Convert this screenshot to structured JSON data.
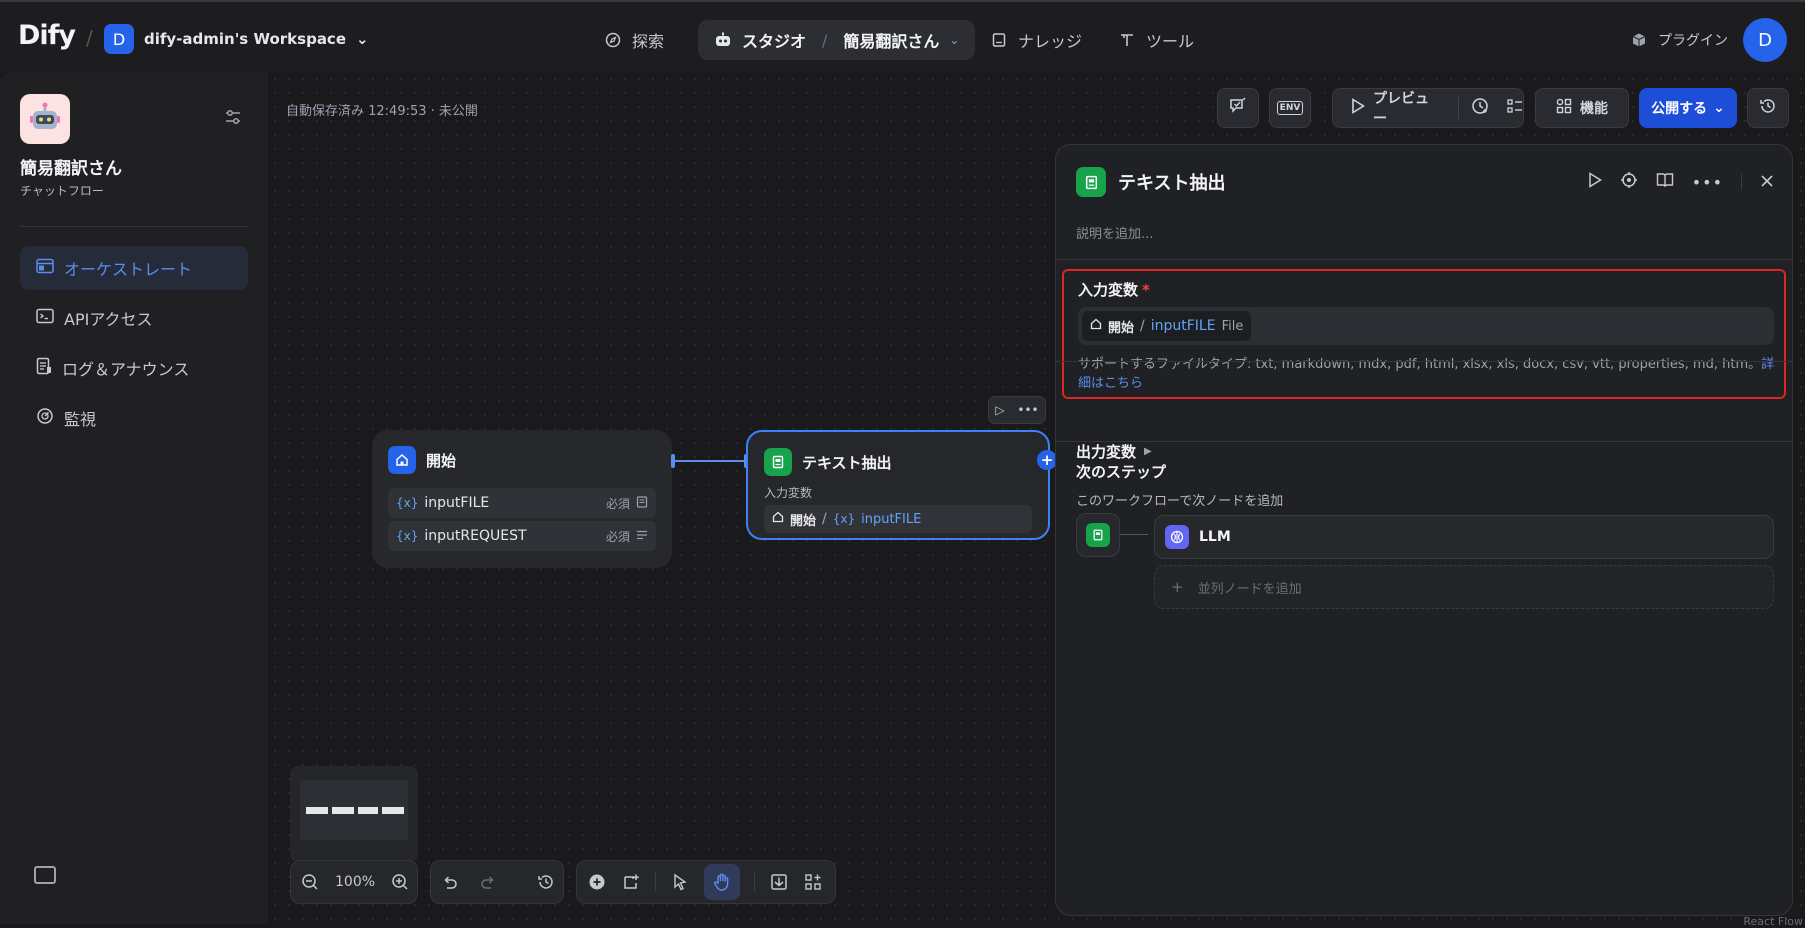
{
  "topbar": {
    "logo": "Dify",
    "workspace_initial": "D",
    "workspace_name": "dify-admin's Workspace",
    "nav": [
      {
        "label": "探索",
        "icon": "compass-icon"
      },
      {
        "label": "スタジオ",
        "icon": "robot-icon"
      },
      {
        "label": "簡易翻訳さん",
        "icon": "chevron-down-icon"
      },
      {
        "label": "ナレッジ",
        "icon": "book-icon"
      },
      {
        "label": "ツール",
        "icon": "tool-icon"
      }
    ],
    "plugins_label": "プラグイン",
    "avatar_initial": "D"
  },
  "sidebar": {
    "app_name": "簡易翻訳さん",
    "app_type": "チャットフロー",
    "items": [
      {
        "label": "オーケストレート",
        "active": true
      },
      {
        "label": "APIアクセス",
        "active": false
      },
      {
        "label": "ログ＆アナウンス",
        "active": false
      },
      {
        "label": "監視",
        "active": false
      }
    ]
  },
  "canvas": {
    "autosave": "自動保存済み 12:49:53 · 未公開",
    "preview_label": "プレビュー",
    "features_label": "機能",
    "publish_label": "公開する",
    "env_label": "ENV",
    "zoom": "100%",
    "react_flow": "React Flow"
  },
  "nodes": {
    "start": {
      "title": "開始",
      "vars": [
        {
          "name": "inputFILE",
          "required": "必須"
        },
        {
          "name": "inputREQUEST",
          "required": "必須"
        }
      ]
    },
    "extract": {
      "title": "テキスト抽出",
      "sub": "入力変数",
      "ref_node": "開始",
      "ref_var": "inputFILE"
    }
  },
  "panel": {
    "title": "テキスト抽出",
    "description_placeholder": "説明を追加...",
    "input_title": "入力変数",
    "required_mark": "*",
    "chip_node": "開始",
    "chip_sep": "/",
    "chip_var": "inputFILE",
    "chip_type": "File",
    "support_text": "サポートするファイルタイプ: txt, markdown, mdx, pdf, html, xlsx, xls, docx, csv, vtt, properties, md, htm。",
    "support_link": "詳細はこちら",
    "output_title": "出力変数",
    "next_title": "次のステップ",
    "next_desc": "このワークフローで次ノードを追加",
    "next_node_label": "LLM",
    "add_parallel": "並列ノードを追加"
  },
  "colors": {
    "accent": "#2563eb",
    "highlight_border": "#dc2626",
    "node_green": "#16a34a"
  }
}
